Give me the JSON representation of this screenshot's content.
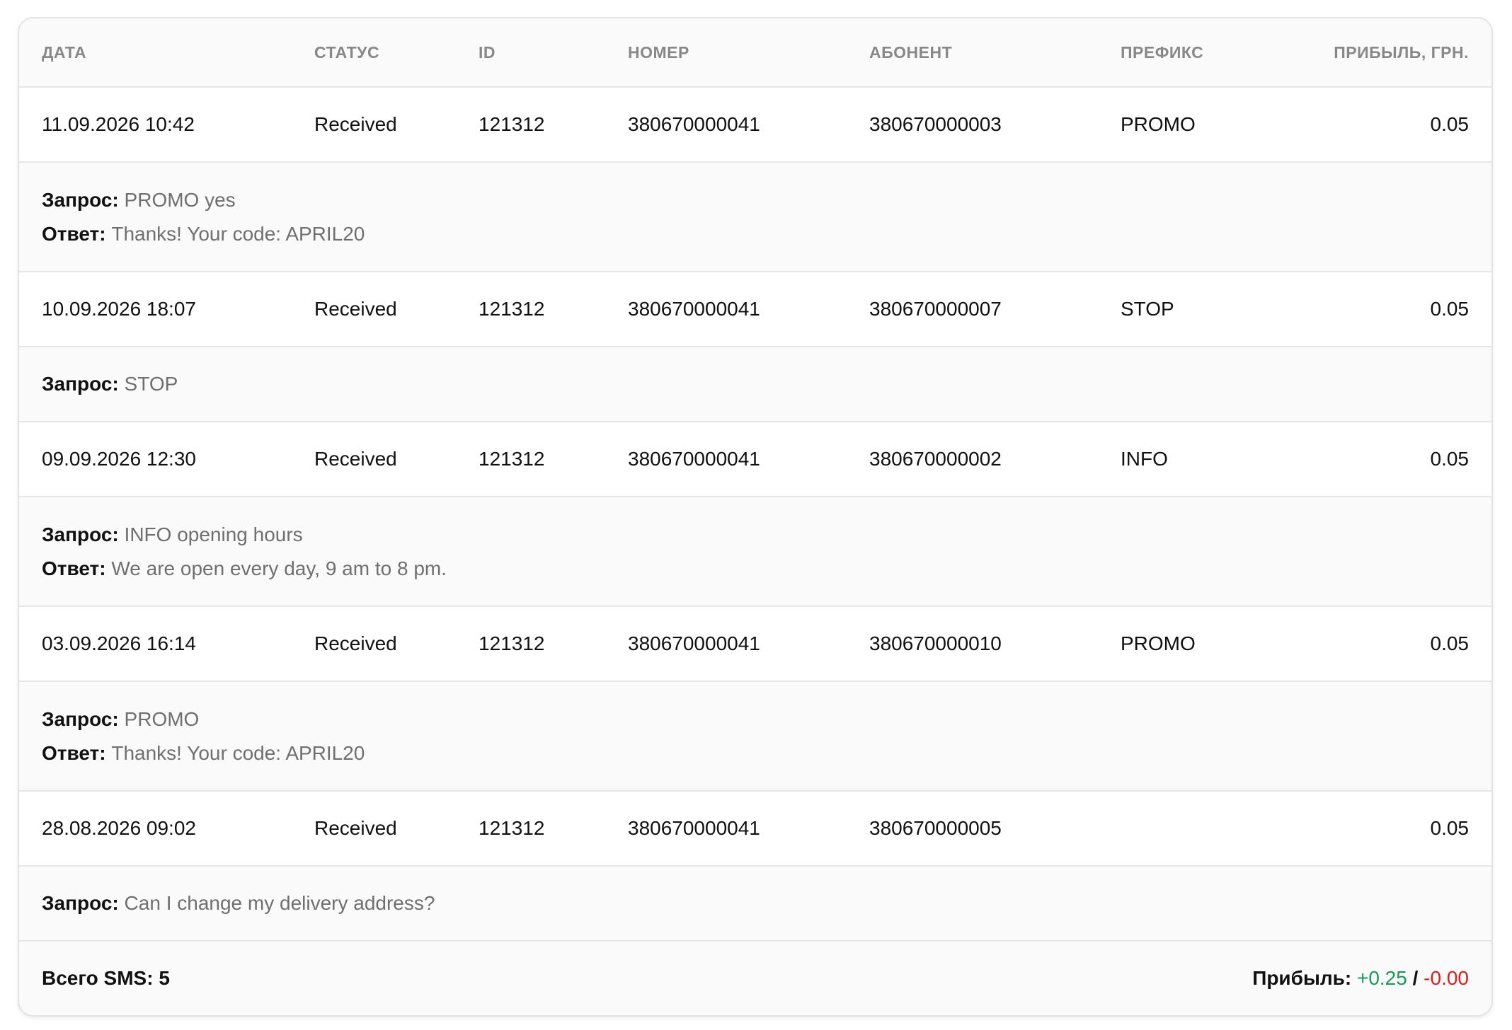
{
  "colors": {
    "profit_positive": "#1a9a5a",
    "profit_negative": "#d91c1c"
  },
  "headers": {
    "date": "ДАТА",
    "status": "СТАТУС",
    "id": "ID",
    "number": "НОМЕР",
    "subscriber": "АБОНЕНТ",
    "prefix": "ПРЕФИКС",
    "profit": "ПРИБЫЛЬ, ГРН."
  },
  "labels": {
    "request": "Запрос:",
    "response": "Ответ:"
  },
  "messages": [
    {
      "date": "11.09.2026 10:42",
      "status": "Received",
      "id": "121312",
      "number": "380670000041",
      "subscriber": "380670000003",
      "prefix": "PROMO",
      "profit": "0.05",
      "request": "PROMO yes",
      "response": "Thanks! Your code: APRIL20"
    },
    {
      "date": "10.09.2026 18:07",
      "status": "Received",
      "id": "121312",
      "number": "380670000041",
      "subscriber": "380670000007",
      "prefix": "STOP",
      "profit": "0.05",
      "request": "STOP",
      "response": null
    },
    {
      "date": "09.09.2026 12:30",
      "status": "Received",
      "id": "121312",
      "number": "380670000041",
      "subscriber": "380670000002",
      "prefix": "INFO",
      "profit": "0.05",
      "request": "INFO opening hours",
      "response": "We are open every day, 9 am to 8 pm."
    },
    {
      "date": "03.09.2026 16:14",
      "status": "Received",
      "id": "121312",
      "number": "380670000041",
      "subscriber": "380670000010",
      "prefix": "PROMO",
      "profit": "0.05",
      "request": "PROMO",
      "response": "Thanks! Your code: APRIL20"
    },
    {
      "date": "28.08.2026 09:02",
      "status": "Received",
      "id": "121312",
      "number": "380670000041",
      "subscriber": "380670000005",
      "prefix": "",
      "profit": "0.05",
      "request": "Can I change my delivery address?",
      "response": null
    }
  ],
  "footer": {
    "total_sms": "Всего SMS: 5",
    "profit_label": "Прибыль:",
    "profit_plus": "+0.25",
    "separator": "/",
    "profit_minus": "-0.00"
  }
}
